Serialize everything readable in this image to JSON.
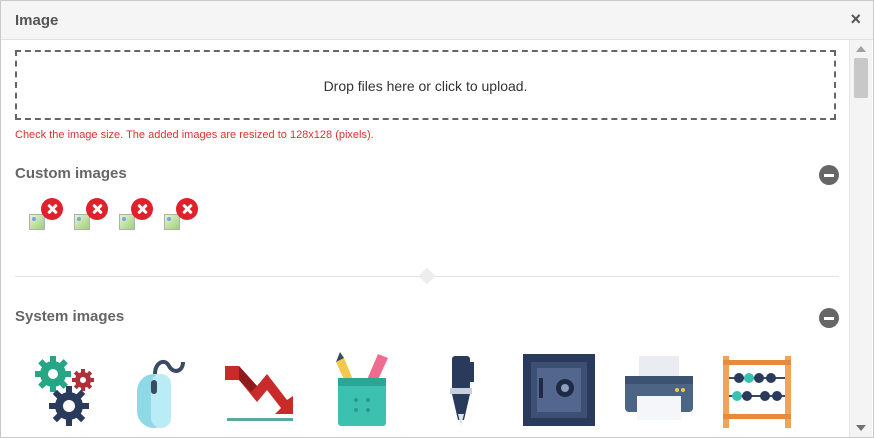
{
  "dialog": {
    "title": "Image",
    "close_symbol": "×"
  },
  "dropzone": {
    "text": "Drop files here or click to upload."
  },
  "warning": "Check the image size. The added images are resized to 128x128 (pixels).",
  "custom_section": {
    "title": "Custom images",
    "image_count": 4
  },
  "system_section": {
    "title": "System images",
    "icons": [
      "gears-icon",
      "computer-mouse-icon",
      "decline-chart-icon",
      "pencil-cup-icon",
      "fountain-pen-icon",
      "safe-icon",
      "printer-icon",
      "abacus-icon"
    ]
  },
  "colors": {
    "warning": "#e03030",
    "remove_badge": "#e0202a",
    "collapse_button": "#666666"
  }
}
